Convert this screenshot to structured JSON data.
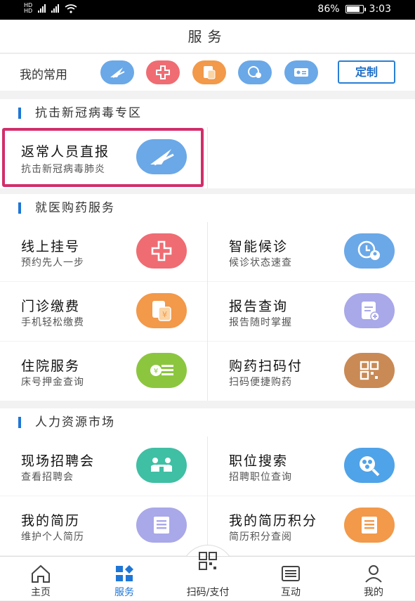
{
  "status": {
    "left_icons": [
      "HD",
      "4G",
      "4G",
      "wifi"
    ],
    "battery": "86%",
    "time": "3:03"
  },
  "header": {
    "title": "服务"
  },
  "favorites": {
    "label": "我的常用",
    "custom_label": "定制",
    "icons": [
      {
        "name": "return-report-icon",
        "color": "#6aa8e8"
      },
      {
        "name": "medical-cross-icon",
        "color": "#ef6c73"
      },
      {
        "name": "payment-icon",
        "color": "#f2994a"
      },
      {
        "name": "waiting-icon",
        "color": "#6aa8e8"
      },
      {
        "name": "id-card-icon",
        "color": "#6aa8e8"
      }
    ]
  },
  "sections": {
    "covid": {
      "title": "抗击新冠病毒专区",
      "items": [
        {
          "title": "返常人员直报",
          "subtitle": "抗击新冠病毒肺炎",
          "color": "#6aa8e8"
        }
      ]
    },
    "medical": {
      "title": "就医购药服务",
      "items": [
        {
          "title": "线上挂号",
          "subtitle": "预约先人一步",
          "color": "#ef6c73"
        },
        {
          "title": "智能候诊",
          "subtitle": "候诊状态速查",
          "color": "#6aa8e8"
        },
        {
          "title": "门诊缴费",
          "subtitle": "手机轻松缴费",
          "color": "#f2994a"
        },
        {
          "title": "报告查询",
          "subtitle": "报告随时掌握",
          "color": "#a9a8e8"
        },
        {
          "title": "住院服务",
          "subtitle": "床号押金查询",
          "color": "#8cc63f"
        },
        {
          "title": "购药扫码付",
          "subtitle": "扫码便捷购药",
          "color": "#c98a55"
        }
      ]
    },
    "hr": {
      "title": "人力资源市场",
      "items": [
        {
          "title": "现场招聘会",
          "subtitle": "查看招聘会",
          "color": "#3fbfa4"
        },
        {
          "title": "职位搜索",
          "subtitle": "招聘职位查询",
          "color": "#4fa3e8"
        },
        {
          "title": "我的简历",
          "subtitle": "维护个人简历",
          "color": "#a9a8e8"
        },
        {
          "title": "我的简历积分",
          "subtitle": "简历积分查阅",
          "color": "#f2994a"
        }
      ]
    }
  },
  "tabs": [
    {
      "label": "主页",
      "icon": "home-icon",
      "active": false
    },
    {
      "label": "服务",
      "icon": "services-icon",
      "active": true
    },
    {
      "label": "扫码/支付",
      "icon": "qr-code-icon",
      "active": false
    },
    {
      "label": "互动",
      "icon": "message-icon",
      "active": false
    },
    {
      "label": "我的",
      "icon": "profile-icon",
      "active": false
    }
  ],
  "colors": {
    "accent": "#1e76d6",
    "highlight": "#d12e6a"
  }
}
